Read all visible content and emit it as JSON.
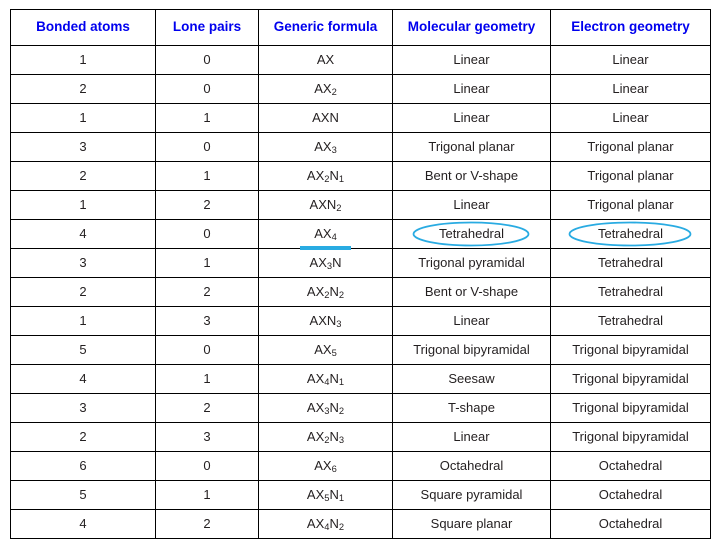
{
  "table": {
    "columns": [
      "Bonded atoms",
      "Lone pairs",
      "Generic formula",
      "Molecular geometry",
      "Electron geometry"
    ],
    "rows": [
      {
        "bonded": "1",
        "lone": "0",
        "formula_base": "AX",
        "formula_sub": "",
        "formula_base2": "",
        "formula_sub2": "",
        "molecular": "Linear",
        "electron": "Linear"
      },
      {
        "bonded": "2",
        "lone": "0",
        "formula_base": "AX",
        "formula_sub": "2",
        "formula_base2": "",
        "formula_sub2": "",
        "molecular": "Linear",
        "electron": "Linear"
      },
      {
        "bonded": "1",
        "lone": "1",
        "formula_base": "AXN",
        "formula_sub": "",
        "formula_base2": "",
        "formula_sub2": "",
        "molecular": "Linear",
        "electron": "Linear"
      },
      {
        "bonded": "3",
        "lone": "0",
        "formula_base": "AX",
        "formula_sub": "3",
        "formula_base2": "",
        "formula_sub2": "",
        "molecular": "Trigonal planar",
        "electron": "Trigonal planar"
      },
      {
        "bonded": "2",
        "lone": "1",
        "formula_base": "AX",
        "formula_sub": "2",
        "formula_base2": "N",
        "formula_sub2": "1",
        "molecular": "Bent or V-shape",
        "electron": "Trigonal planar"
      },
      {
        "bonded": "1",
        "lone": "2",
        "formula_base": "AXN",
        "formula_sub": "2",
        "formula_base2": "",
        "formula_sub2": "",
        "molecular": "Linear",
        "electron": "Trigonal planar"
      },
      {
        "bonded": "4",
        "lone": "0",
        "formula_base": "AX",
        "formula_sub": "4",
        "formula_base2": "",
        "formula_sub2": "",
        "molecular": "Tetrahedral",
        "electron": "Tetrahedral",
        "highlight_formula": true,
        "highlight_molecular": true,
        "highlight_electron": true
      },
      {
        "bonded": "3",
        "lone": "1",
        "formula_base": "AX",
        "formula_sub": "3",
        "formula_base2": "N",
        "formula_sub2": "",
        "molecular": "Trigonal pyramidal",
        "electron": "Tetrahedral"
      },
      {
        "bonded": "2",
        "lone": "2",
        "formula_base": "AX",
        "formula_sub": "2",
        "formula_base2": "N",
        "formula_sub2": "2",
        "molecular": "Bent or V-shape",
        "electron": "Tetrahedral"
      },
      {
        "bonded": "1",
        "lone": "3",
        "formula_base": "AXN",
        "formula_sub": "3",
        "formula_base2": "",
        "formula_sub2": "",
        "molecular": "Linear",
        "electron": "Tetrahedral"
      },
      {
        "bonded": "5",
        "lone": "0",
        "formula_base": "AX",
        "formula_sub": "5",
        "formula_base2": "",
        "formula_sub2": "",
        "molecular": "Trigonal bipyramidal",
        "electron": "Trigonal bipyramidal"
      },
      {
        "bonded": "4",
        "lone": "1",
        "formula_base": "AX",
        "formula_sub": "4",
        "formula_base2": "N",
        "formula_sub2": "1",
        "molecular": "Seesaw",
        "electron": "Trigonal bipyramidal"
      },
      {
        "bonded": "3",
        "lone": "2",
        "formula_base": "AX",
        "formula_sub": "3",
        "formula_base2": "N",
        "formula_sub2": "2",
        "molecular": "T-shape",
        "electron": "Trigonal bipyramidal"
      },
      {
        "bonded": "2",
        "lone": "3",
        "formula_base": "AX",
        "formula_sub": "2",
        "formula_base2": "N",
        "formula_sub2": "3",
        "molecular": "Linear",
        "electron": "Trigonal bipyramidal"
      },
      {
        "bonded": "6",
        "lone": "0",
        "formula_base": "AX",
        "formula_sub": "6",
        "formula_base2": "",
        "formula_sub2": "",
        "molecular": "Octahedral",
        "electron": "Octahedral"
      },
      {
        "bonded": "5",
        "lone": "1",
        "formula_base": "AX",
        "formula_sub": "5",
        "formula_base2": "N",
        "formula_sub2": "1",
        "molecular": "Square pyramidal",
        "electron": "Octahedral"
      },
      {
        "bonded": "4",
        "lone": "2",
        "formula_base": "AX",
        "formula_sub": "4",
        "formula_base2": "N",
        "formula_sub2": "2",
        "molecular": "Square planar",
        "electron": "Octahedral"
      }
    ]
  },
  "colors": {
    "header_text": "#0000ee",
    "formula_text": "#ee1111",
    "body_text": "#231f20",
    "annotation": "#29ABE2",
    "border": "#000000"
  }
}
